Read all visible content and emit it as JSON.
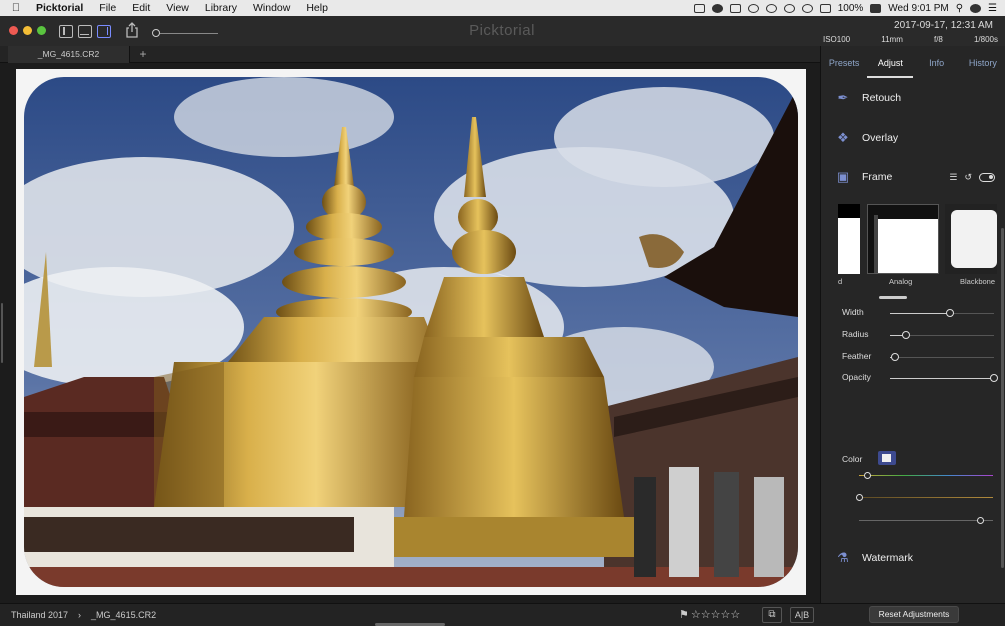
{
  "menubar": {
    "app_name": "Picktorial",
    "menus": [
      "File",
      "Edit",
      "View",
      "Library",
      "Window",
      "Help"
    ],
    "battery": "100%",
    "clock": "Wed 9:01 PM"
  },
  "toolbar": {
    "title": "Picktorial",
    "date": "2017-09-17, 12:31 AM",
    "exif": {
      "iso": "ISO100",
      "focal": "11mm",
      "aperture": "f/8",
      "shutter": "1/800s"
    },
    "zoom_level": 0
  },
  "tabs": {
    "file": "_MG_4615.CR2",
    "add": "+"
  },
  "panel": {
    "tabs": [
      "Presets",
      "Adjust",
      "Info",
      "History"
    ],
    "active_tab": "Adjust",
    "sections": {
      "retouch": "Retouch",
      "overlay": "Overlay",
      "frame": "Frame",
      "watermark": "Watermark"
    },
    "frame_thumbs": [
      "d",
      "Analog",
      "Blackbone"
    ],
    "sliders": [
      {
        "label": "Width",
        "value": 0.58
      },
      {
        "label": "Radius",
        "value": 0.15
      },
      {
        "label": "Feather",
        "value": 0.05
      },
      {
        "label": "Opacity",
        "value": 1.0
      }
    ],
    "color_label": "Color",
    "color_sliders": {
      "hue": 0.06,
      "saturation": 0.0,
      "luminance": 0.9
    },
    "colors": {
      "accent": "#7c8fd0",
      "swatch": "#f0f0f0"
    }
  },
  "statusbar": {
    "album": "Thailand 2017",
    "separator": "›",
    "file": "_MG_4615.CR2",
    "stars": "☆☆☆☆☆",
    "ab": "A|B",
    "reset": "Reset Adjustments"
  }
}
